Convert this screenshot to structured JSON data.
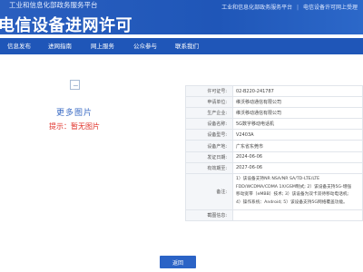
{
  "header": {
    "top_title": "工业和信息化部政务服务平台",
    "top_links": [
      "工业和信息化部政务服务平台",
      "|",
      "电信设备许可网上受理"
    ],
    "site_title": "电信设备进网许可"
  },
  "nav": {
    "items": [
      {
        "label": "信息发布"
      },
      {
        "label": "进网指南"
      },
      {
        "label": "网上服务"
      },
      {
        "label": "公众参与"
      },
      {
        "label": "联系我们"
      }
    ]
  },
  "image_panel": {
    "more_label": "更多图片",
    "tip": "提示：暂无图片"
  },
  "details": {
    "rows": [
      {
        "label": "许可证号:",
        "value": "02-B220-241787"
      },
      {
        "label": "申请单位:",
        "value": "维沃移动通信有限公司"
      },
      {
        "label": "生产企业:",
        "value": "维沃移动通信有限公司"
      },
      {
        "label": "设备名称:",
        "value": "5G数字移动电话机"
      },
      {
        "label": "设备型号:",
        "value": "V2403A"
      },
      {
        "label": "设备产地:",
        "value": "广东省东莞市"
      },
      {
        "label": "发证日期:",
        "value": "2024-06-06"
      },
      {
        "label": "有效期至:",
        "value": "2027-06-06"
      }
    ],
    "note_label": "备注:",
    "note_lines": [
      "1）该设备支持NR NSA/NR SA/TD-LTE/LTE",
      "FDD/WCDMA/CDMA 1X/GSM制式; 2）该设备支持5G-增强",
      "移动宽带（eMBB）技术; 3）该设备为双卡双待移动电话机;",
      "4）操作系统：Android; 5）该设备支持5G网络覆盖功能。"
    ],
    "extra_label": "截图信息:"
  },
  "back_button": {
    "label": "返回"
  }
}
